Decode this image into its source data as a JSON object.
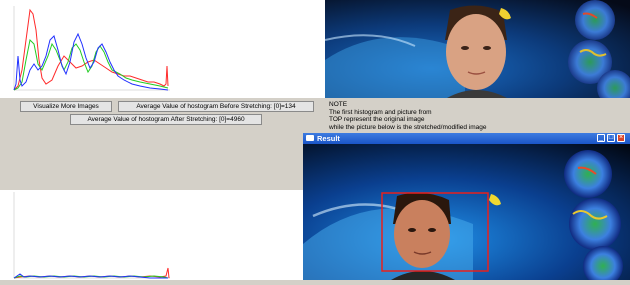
{
  "controls": {
    "visualize_button": "Visualize More Images",
    "avg_before": "Average Value of hostogram Before Stretching: [0]=134",
    "avg_after": "Average Value of hostogram After Stretching: [0]=4960"
  },
  "note": {
    "lines": [
      "NOTE",
      "The first histogram and picture from",
      " TOP represent the original image",
      "while the picture below is the stretched/modified image"
    ]
  },
  "result_window": {
    "title": "Result"
  },
  "colors": {
    "histogram_red": "#ff2a2a",
    "histogram_green": "#22cc22",
    "histogram_blue": "#2030ff",
    "face_box": "#e8201c",
    "titlebar": "#2a64d8"
  }
}
